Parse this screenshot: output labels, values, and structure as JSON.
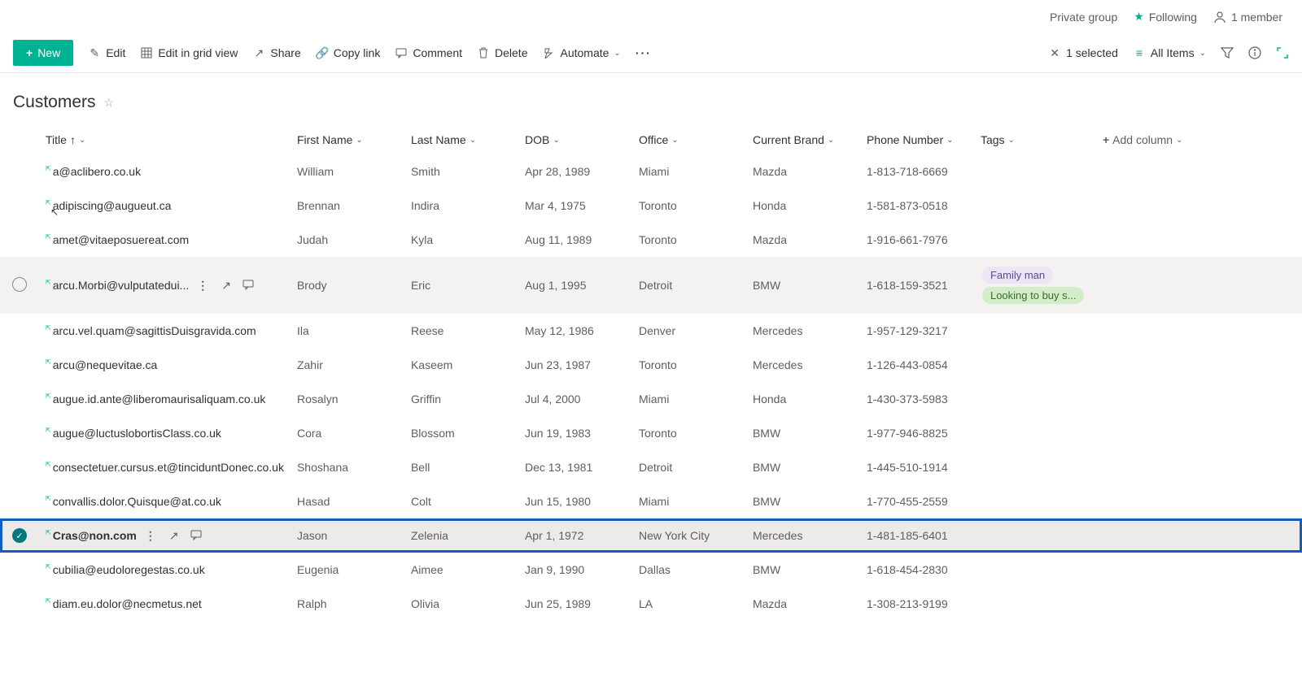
{
  "header": {
    "private_group": "Private group",
    "following": "Following",
    "member": "1 member"
  },
  "commandBar": {
    "new": "New",
    "edit": "Edit",
    "edit_grid": "Edit in grid view",
    "share": "Share",
    "copy_link": "Copy link",
    "comment": "Comment",
    "delete": "Delete",
    "automate": "Automate",
    "selected": "1 selected",
    "view": "All Items"
  },
  "listTitle": "Customers",
  "columns": {
    "title": "Title",
    "first_name": "First Name",
    "last_name": "Last Name",
    "dob": "DOB",
    "office": "Office",
    "brand": "Current Brand",
    "phone": "Phone Number",
    "tags": "Tags",
    "add": "Add column"
  },
  "rows": [
    {
      "title": "a@aclibero.co.uk",
      "fn": "William",
      "ln": "Smith",
      "dob": "Apr 28, 1989",
      "off": "Miami",
      "brand": "Mazda",
      "phone": "1-813-718-6669",
      "tags": [],
      "state": "",
      "showActions": false,
      "selCircle": false,
      "bold": false
    },
    {
      "title": "adipiscing@augueut.ca",
      "fn": "Brennan",
      "ln": "Indira",
      "dob": "Mar 4, 1975",
      "off": "Toronto",
      "brand": "Honda",
      "phone": "1-581-873-0518",
      "tags": [],
      "state": "",
      "showActions": false,
      "selCircle": false,
      "bold": false,
      "cursor": true
    },
    {
      "title": "amet@vitaeposuereat.com",
      "fn": "Judah",
      "ln": "Kyla",
      "dob": "Aug 11, 1989",
      "off": "Toronto",
      "brand": "Mazda",
      "phone": "1-916-661-7976",
      "tags": [],
      "state": "",
      "showActions": false,
      "selCircle": false,
      "bold": false
    },
    {
      "title": "arcu.Morbi@vulputatedui...",
      "fn": "Brody",
      "ln": "Eric",
      "dob": "Aug 1, 1995",
      "off": "Detroit",
      "brand": "BMW",
      "phone": "1-618-159-3521",
      "tags": [
        {
          "t": "Family man",
          "c": "purple"
        },
        {
          "t": "Looking to buy s...",
          "c": "green"
        }
      ],
      "state": "hover",
      "showActions": true,
      "selCircle": true,
      "bold": false
    },
    {
      "title": "arcu.vel.quam@sagittisDuisgravida.com",
      "fn": "Ila",
      "ln": "Reese",
      "dob": "May 12, 1986",
      "off": "Denver",
      "brand": "Mercedes",
      "phone": "1-957-129-3217",
      "tags": [],
      "state": "",
      "showActions": false,
      "selCircle": false,
      "bold": false
    },
    {
      "title": "arcu@nequevitae.ca",
      "fn": "Zahir",
      "ln": "Kaseem",
      "dob": "Jun 23, 1987",
      "off": "Toronto",
      "brand": "Mercedes",
      "phone": "1-126-443-0854",
      "tags": [],
      "state": "",
      "showActions": false,
      "selCircle": false,
      "bold": false
    },
    {
      "title": "augue.id.ante@liberomaurisaliquam.co.uk",
      "fn": "Rosalyn",
      "ln": "Griffin",
      "dob": "Jul 4, 2000",
      "off": "Miami",
      "brand": "Honda",
      "phone": "1-430-373-5983",
      "tags": [],
      "state": "",
      "showActions": false,
      "selCircle": false,
      "bold": false
    },
    {
      "title": "augue@luctuslobortisClass.co.uk",
      "fn": "Cora",
      "ln": "Blossom",
      "dob": "Jun 19, 1983",
      "off": "Toronto",
      "brand": "BMW",
      "phone": "1-977-946-8825",
      "tags": [],
      "state": "",
      "showActions": false,
      "selCircle": false,
      "bold": false
    },
    {
      "title": "consectetuer.cursus.et@tinciduntDonec.co.uk",
      "fn": "Shoshana",
      "ln": "Bell",
      "dob": "Dec 13, 1981",
      "off": "Detroit",
      "brand": "BMW",
      "phone": "1-445-510-1914",
      "tags": [],
      "state": "",
      "showActions": false,
      "selCircle": false,
      "bold": false
    },
    {
      "title": "convallis.dolor.Quisque@at.co.uk",
      "fn": "Hasad",
      "ln": "Colt",
      "dob": "Jun 15, 1980",
      "off": "Miami",
      "brand": "BMW",
      "phone": "1-770-455-2559",
      "tags": [],
      "state": "",
      "showActions": false,
      "selCircle": false,
      "bold": false
    },
    {
      "title": "Cras@non.com",
      "fn": "Jason",
      "ln": "Zelenia",
      "dob": "Apr 1, 1972",
      "off": "New York City",
      "brand": "Mercedes",
      "phone": "1-481-185-6401",
      "tags": [],
      "state": "selected highlighted",
      "showActions": true,
      "selCircle": false,
      "selCheck": true,
      "bold": true
    },
    {
      "title": "cubilia@eudoloregestas.co.uk",
      "fn": "Eugenia",
      "ln": "Aimee",
      "dob": "Jan 9, 1990",
      "off": "Dallas",
      "brand": "BMW",
      "phone": "1-618-454-2830",
      "tags": [],
      "state": "",
      "showActions": false,
      "selCircle": false,
      "bold": false
    },
    {
      "title": "diam.eu.dolor@necmetus.net",
      "fn": "Ralph",
      "ln": "Olivia",
      "dob": "Jun 25, 1989",
      "off": "LA",
      "brand": "Mazda",
      "phone": "1-308-213-9199",
      "tags": [],
      "state": "",
      "showActions": false,
      "selCircle": false,
      "bold": false
    }
  ]
}
